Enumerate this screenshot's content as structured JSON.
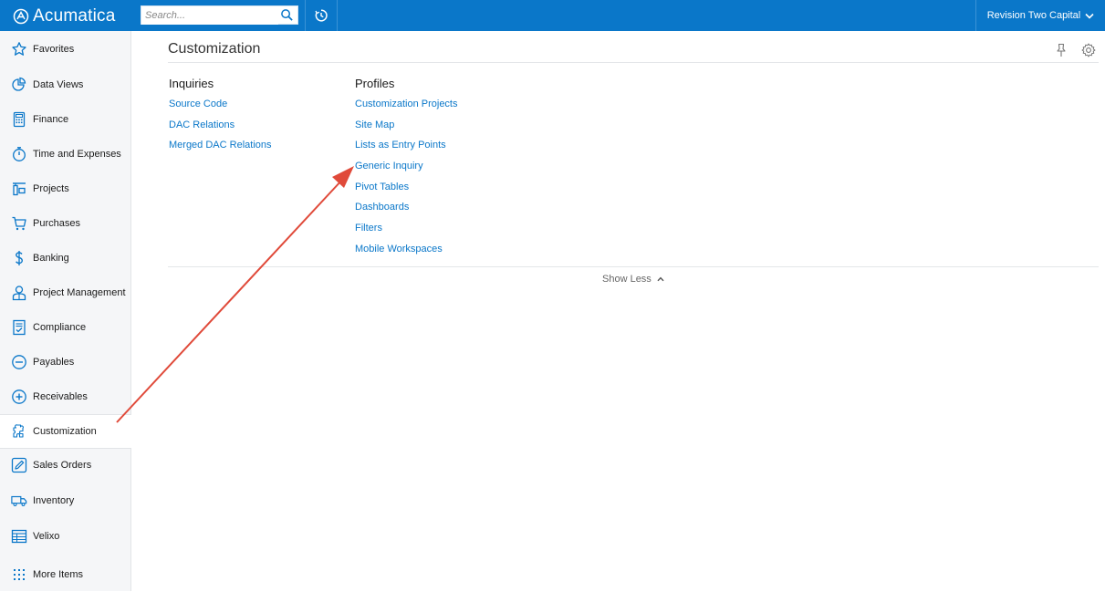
{
  "brand": {
    "name": "Acumatica",
    "accent": "#0a77c9",
    "annotation_color": "#e04a3a"
  },
  "search": {
    "placeholder": "Search...",
    "value": ""
  },
  "company": {
    "name": "Revision Two Capital"
  },
  "sidebar": {
    "items": [
      {
        "label": "Favorites",
        "icon": "star-icon"
      },
      {
        "label": "Data Views",
        "icon": "pie-chart-icon"
      },
      {
        "label": "Finance",
        "icon": "calculator-icon"
      },
      {
        "label": "Time and Expenses",
        "icon": "stopwatch-icon"
      },
      {
        "label": "Projects",
        "icon": "projects-icon"
      },
      {
        "label": "Purchases",
        "icon": "cart-icon"
      },
      {
        "label": "Banking",
        "icon": "dollar-icon"
      },
      {
        "label": "Project Management",
        "icon": "person-icon"
      },
      {
        "label": "Compliance",
        "icon": "document-check-icon"
      },
      {
        "label": "Payables",
        "icon": "minus-circle-icon"
      },
      {
        "label": "Receivables",
        "icon": "plus-circle-icon"
      },
      {
        "label": "Customization",
        "icon": "puzzle-icon",
        "active": true
      },
      {
        "label": "Sales Orders",
        "icon": "pencil-icon"
      },
      {
        "label": "Inventory",
        "icon": "truck-icon"
      },
      {
        "label": "Velixo",
        "icon": "spreadsheet-icon"
      },
      {
        "label": "More Items",
        "icon": "grid-dots-icon"
      }
    ]
  },
  "main": {
    "title": "Customization",
    "inquiries": {
      "heading": "Inquiries",
      "links": [
        "Source Code",
        "DAC Relations",
        "Merged DAC Relations"
      ]
    },
    "profiles": {
      "heading": "Profiles",
      "links": [
        "Customization Projects",
        "Site Map",
        "Lists as Entry Points",
        "Generic Inquiry",
        "Pivot Tables",
        "Dashboards",
        "Filters",
        "Mobile Workspaces"
      ]
    },
    "show_less": "Show Less"
  }
}
